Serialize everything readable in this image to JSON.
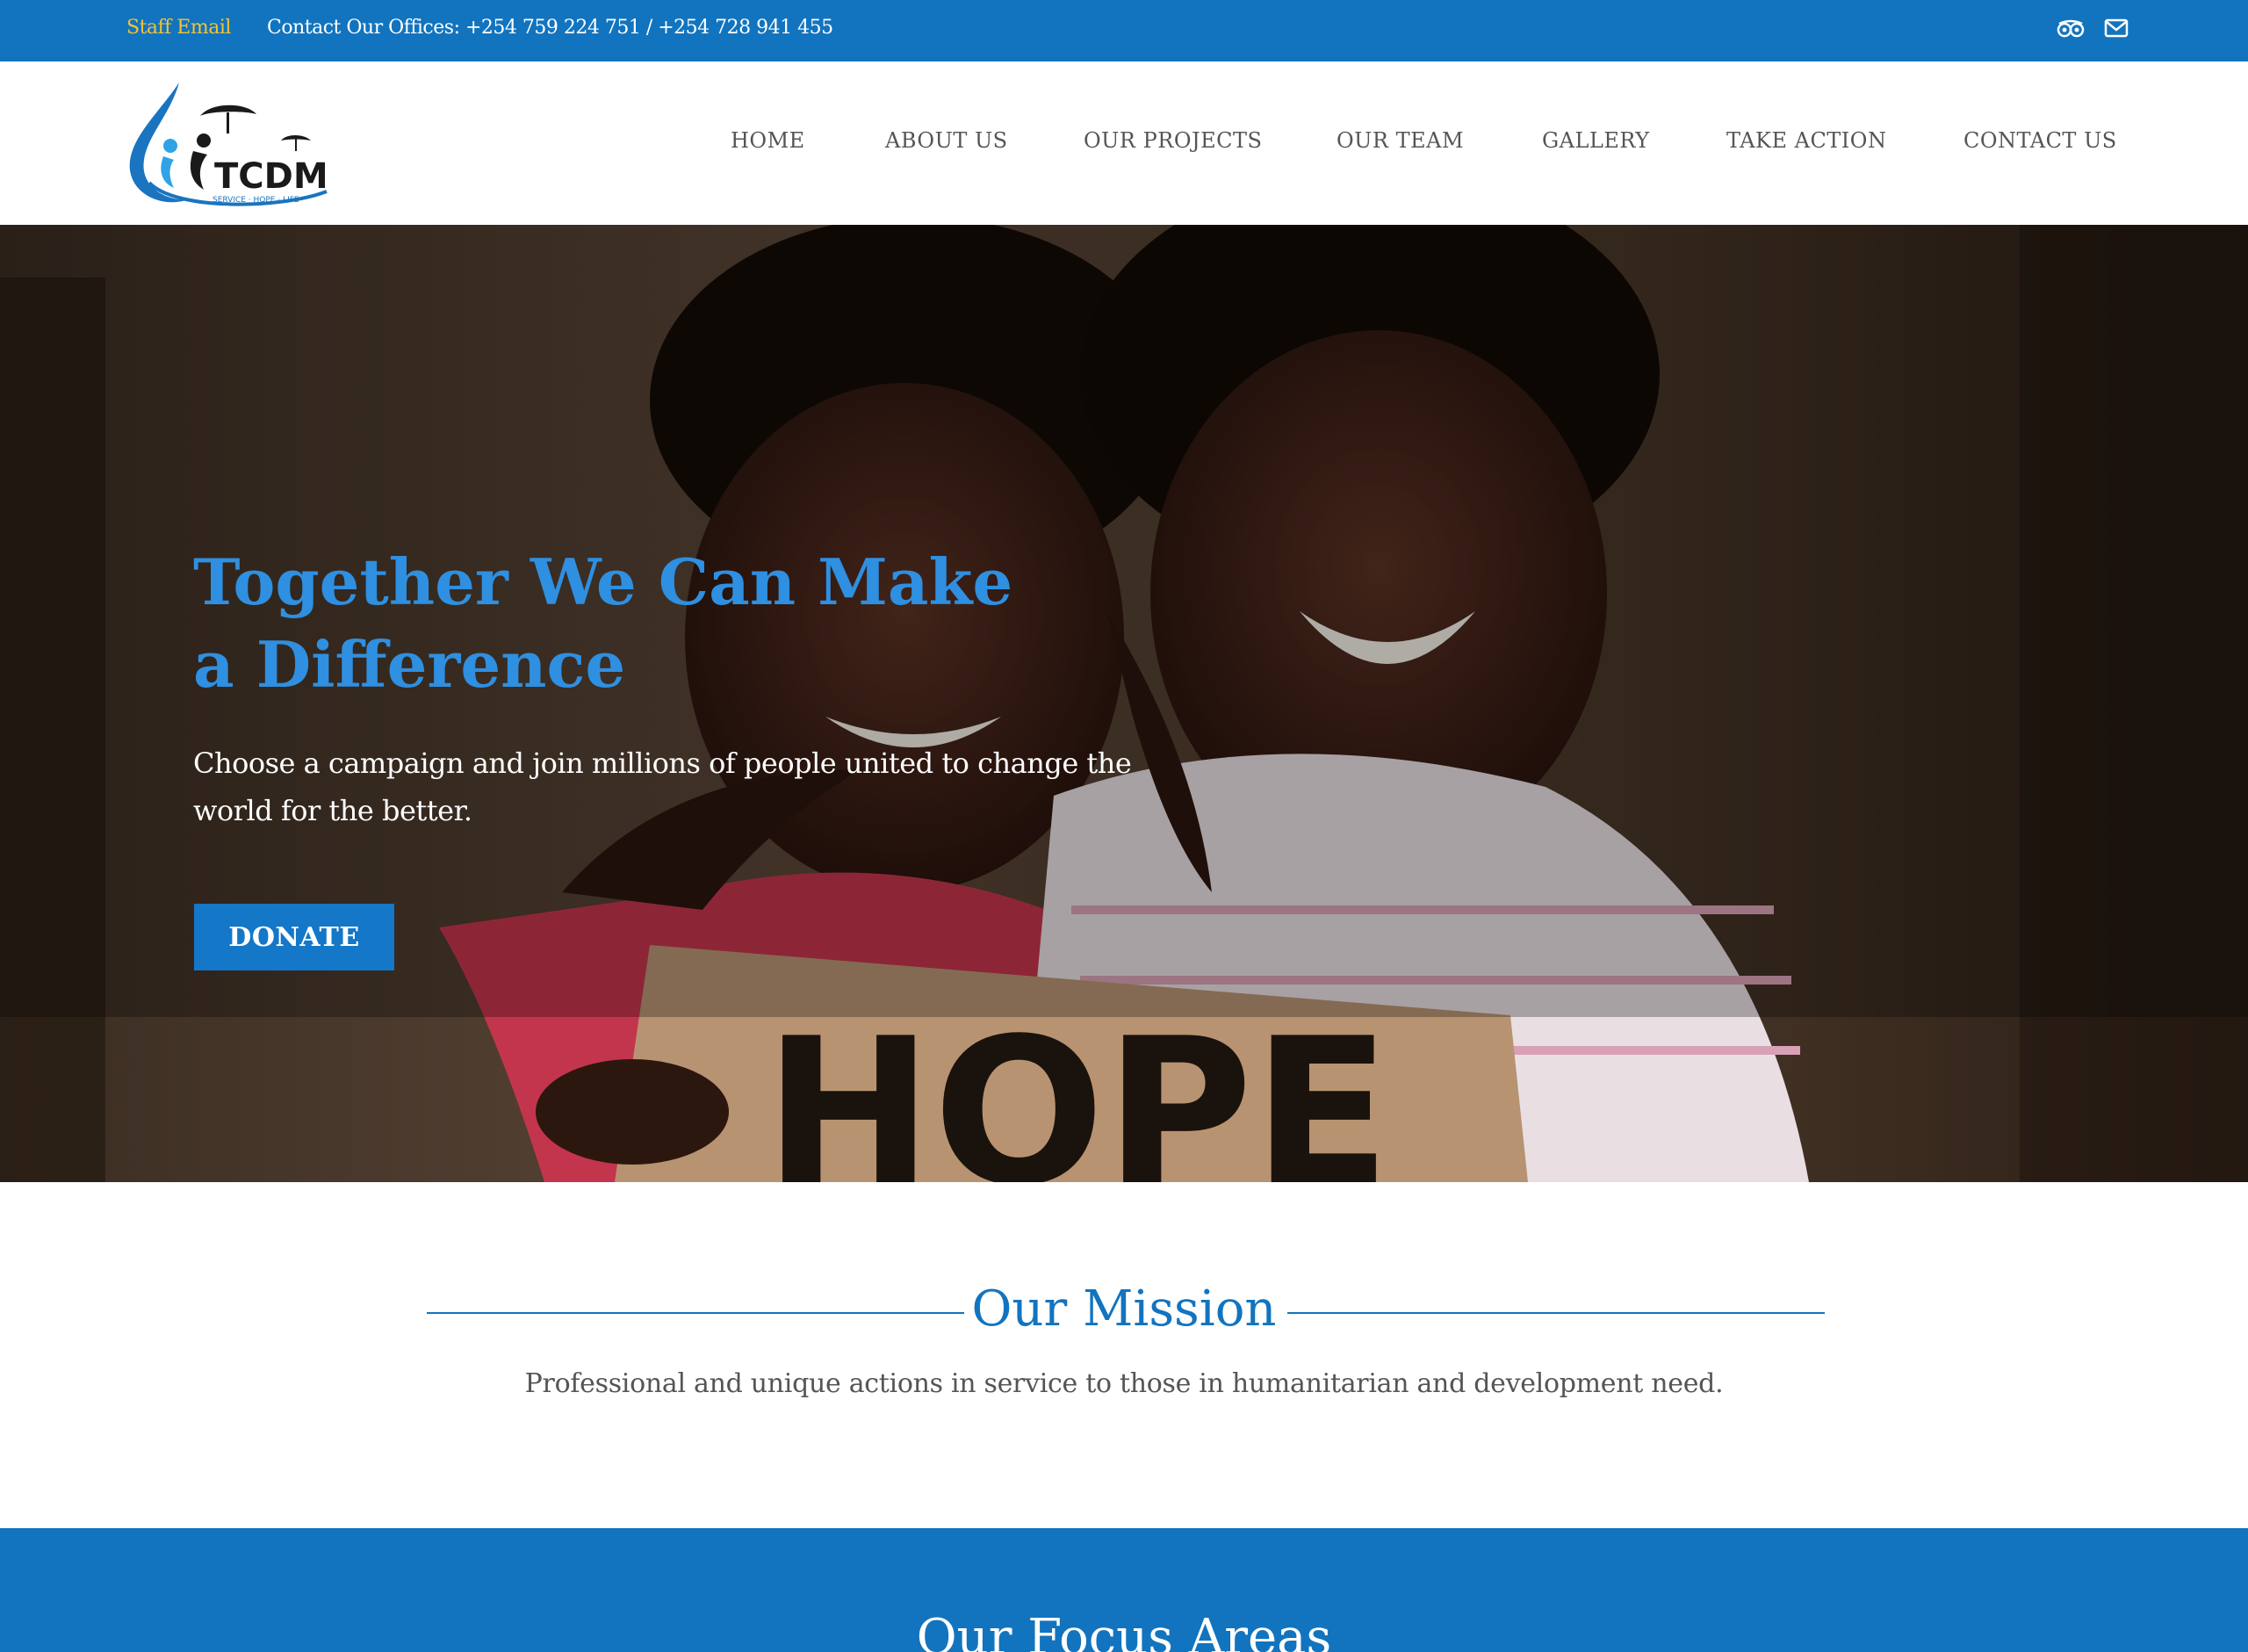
{
  "topbar": {
    "staff_email_label": "Staff Email",
    "contact_text": "Contact Our Offices: +254 759 224 751 / +254 728 941 455",
    "icons": [
      "tripadvisor-icon",
      "mail-icon"
    ],
    "bg_color": "#1274bf",
    "accent_color": "#f3c234"
  },
  "header": {
    "logo_text": "TCDM",
    "logo_tagline": "SERVICE · HOPE · LIFE",
    "nav": [
      {
        "label": "HOME"
      },
      {
        "label": "ABOUT US"
      },
      {
        "label": "OUR PROJECTS"
      },
      {
        "label": "OUR TEAM"
      },
      {
        "label": "GALLERY"
      },
      {
        "label": "TAKE ACTION"
      },
      {
        "label": "CONTACT US"
      }
    ]
  },
  "hero": {
    "title": "Together We Can Make a Difference",
    "subtitle": "Choose a campaign and join millions of people united to change the world for the better.",
    "donate_label": "DONATE",
    "sign_text": "HOPE",
    "title_color": "#2f8fe0"
  },
  "mission": {
    "title": "Our Mission",
    "text": "Professional and unique actions in service to those in humanitarian and development need."
  },
  "focus": {
    "title": "Our Focus Areas"
  }
}
